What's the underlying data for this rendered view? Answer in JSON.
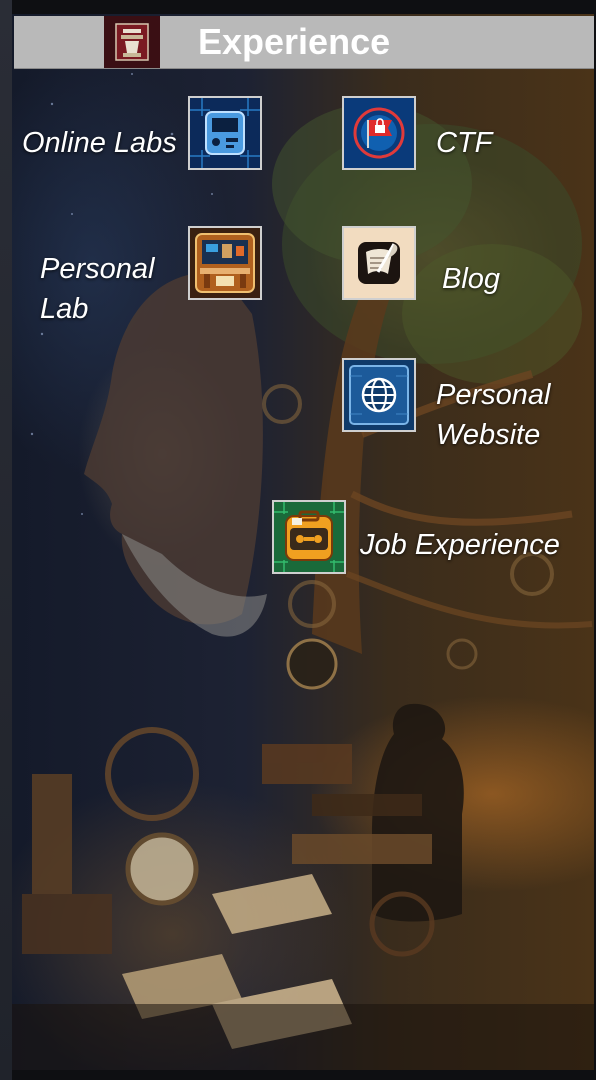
{
  "header": {
    "title": "Experience",
    "logo_icon": "chess-logo-icon"
  },
  "items": {
    "online_labs": {
      "label": "Online Labs",
      "icon": "circuit-device-icon"
    },
    "ctf": {
      "label": "CTF",
      "icon": "flag-lock-icon"
    },
    "personal_lab": {
      "label": "Personal Lab",
      "icon": "workbench-icon"
    },
    "blog": {
      "label": "Blog",
      "icon": "scroll-quill-icon"
    },
    "personal_website": {
      "label": "Personal Website",
      "icon": "globe-icon"
    },
    "job_experience": {
      "label": "Job Experience",
      "icon": "toolbox-icon"
    }
  },
  "colors": {
    "header_bg": "#b9b9b9",
    "logo_bg": "#3a0f14",
    "label_text": "#ffffff"
  }
}
